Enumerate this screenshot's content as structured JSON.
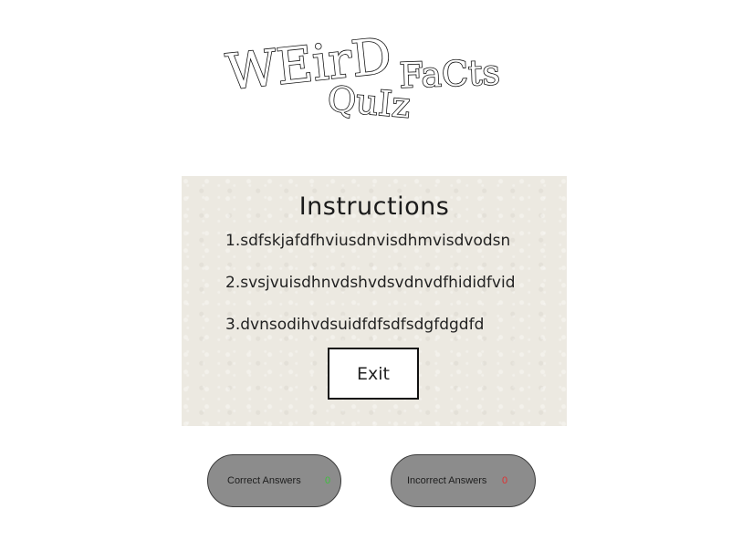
{
  "logo": {
    "line1": "WEirD",
    "line2": "QuIz",
    "line3": "FaCts"
  },
  "instructions": {
    "title": "Instructions",
    "items": [
      "1.sdfskjafdfhviusdnvisdhmvisdvodsn",
      "2.svsjvuisdhnvdshvdsvdnvdfhididfvid",
      "3.dvnsodihvdsuidfdfsdfsdgfdgdfd"
    ],
    "exit_label": "Exit"
  },
  "scores": {
    "correct_label": "Correct Answers",
    "correct_value": "0",
    "correct_color": "#3fbf3f",
    "incorrect_label": "Incorrect Answers",
    "incorrect_value": "0",
    "incorrect_color": "#e03030"
  },
  "colors": {
    "panel_background": "#ece9e1",
    "pill_background": "#8c8c8c"
  }
}
